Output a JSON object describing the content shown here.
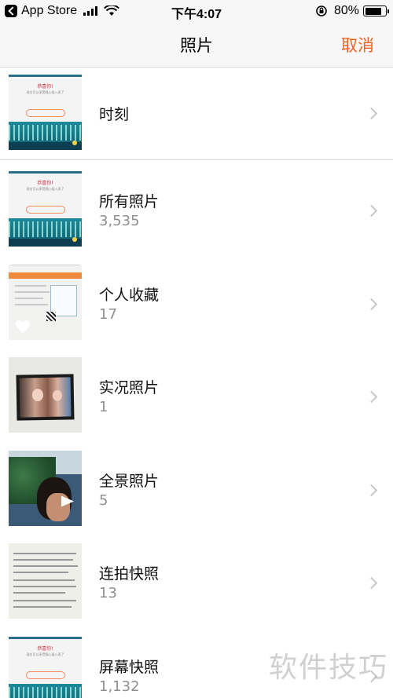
{
  "status_bar": {
    "back_app": "App Store",
    "time": "下午4:07",
    "battery": "80%",
    "battery_level": 0.8
  },
  "nav": {
    "title": "照片",
    "cancel_label": "取消",
    "accent_color": "#ee6324"
  },
  "albums": [
    {
      "name": "时刻",
      "count": ""
    },
    {
      "name": "所有照片",
      "count": "3,535"
    },
    {
      "name": "个人收藏",
      "count": "17"
    },
    {
      "name": "实况照片",
      "count": "1"
    },
    {
      "name": "全景照片",
      "count": "5"
    },
    {
      "name": "连拍快照",
      "count": "13"
    },
    {
      "name": "屏幕快照",
      "count": "1,132"
    }
  ],
  "thumb_text": {
    "shot_title": "恭喜你!",
    "shot_sub": "现在可以享受随心插入表了",
    "shot_button": "我知道了"
  },
  "watermark": "软件技巧"
}
